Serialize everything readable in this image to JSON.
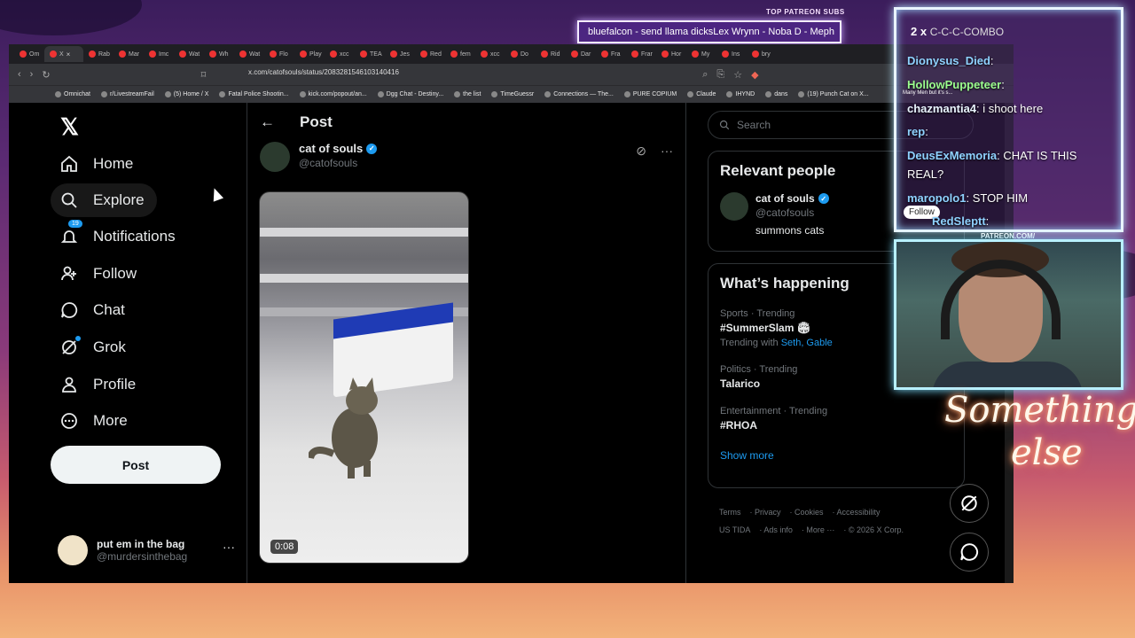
{
  "overlay": {
    "top_subs_label": "TOP PATREON SUBS",
    "ticker_text": "bluefalcon - send llama dicksLex Wrynn - Noba D - Meph",
    "patreon_label": "PATREON.COM/",
    "brand_line1": "Something",
    "brand_line2": "else"
  },
  "browser": {
    "url": "x.com/catofsouls/status/2083281546103140416",
    "tabs": [
      "Om",
      "X",
      "Rab",
      "Mar",
      "Imc",
      "Wat",
      "Wh",
      "Wat",
      "Flo",
      "Play",
      "xcc",
      "TEA",
      "Jes",
      "Red",
      "fem",
      "xcc",
      "Do",
      "Rid",
      "Dar",
      "Fra",
      "Frar",
      "Hor",
      "My",
      "Ins",
      "bry"
    ],
    "bookmarks": [
      "Omnichat",
      "r/LivestreamFail",
      "(5) Home / X",
      "Fatal Police Shootin...",
      "kick.com/popout/an...",
      "Dgg Chat - Destiny...",
      "the list",
      "TimeGuessr",
      "Connections — The...",
      "PURE COPIUM",
      "Claude",
      "IHYND",
      "dans",
      "(19) Punch Cat on X..."
    ]
  },
  "nav": {
    "home": "Home",
    "explore": "Explore",
    "notifications": "Notifications",
    "notifications_count": "19",
    "follow": "Follow",
    "chat": "Chat",
    "grok": "Grok",
    "profile": "Profile",
    "more": "More",
    "post_button": "Post"
  },
  "account": {
    "name": "put em in the bag",
    "handle": "@murdersinthebag"
  },
  "post": {
    "header": "Post",
    "author_name": "cat of souls",
    "author_handle": "@catofsouls",
    "video_duration": "0:08"
  },
  "sidebar": {
    "search_placeholder": "Search",
    "relevant_title": "Relevant people",
    "person_name": "cat of souls",
    "person_handle": "@catofsouls",
    "person_bio": "summons cats",
    "happening_title": "What’s happening",
    "trends": [
      {
        "meta": "Sports · Trending",
        "title": "#SummerSlam 🏟",
        "with_prefix": "Trending with",
        "with_names": "Seth, Gable"
      },
      {
        "meta": "Politics · Trending",
        "title": "Talarico"
      },
      {
        "meta": "Entertainment · Trending",
        "title": "#RHOA"
      }
    ],
    "show_more": "Show more",
    "footer": [
      "Terms",
      "Privacy",
      "Cookies",
      "Accessibility",
      "US TIDA",
      "Ads info",
      "More ···",
      "© 2026 X Corp."
    ]
  },
  "chat": {
    "combo_count": "2",
    "combo_x": "x",
    "combo_text": "C-C-C-COMBO",
    "tiny_text": "Many Men but it's s...",
    "follow_pill": "Follow",
    "messages": [
      {
        "user": "Dionysus_Died",
        "text": ":"
      },
      {
        "user": "HollowPuppeteer",
        "text": ":"
      },
      {
        "user": "chazmantia4",
        "text": ": i shoot here"
      },
      {
        "user": "rep",
        "text": ":"
      },
      {
        "user": "DeusExMemoria",
        "text": ": CHAT IS THIS"
      },
      {
        "user": "",
        "text": "REAL?"
      },
      {
        "user": "maropolo1",
        "text": ": STOP HIM"
      },
      {
        "user": "RedSleptt",
        "text": ":"
      }
    ]
  }
}
